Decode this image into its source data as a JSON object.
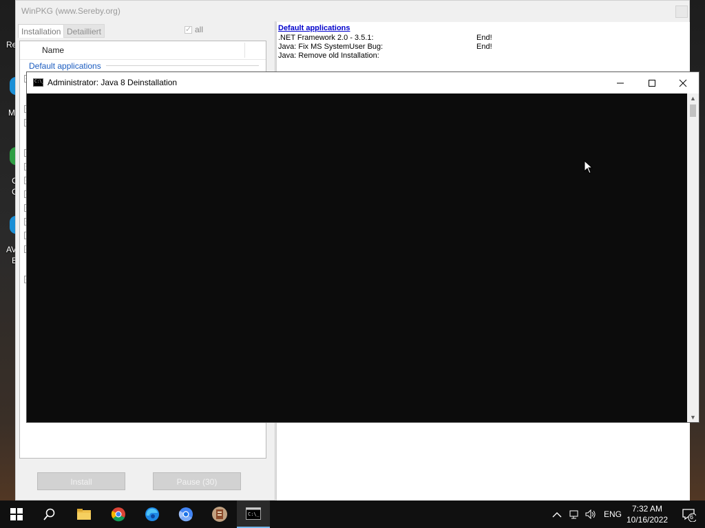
{
  "desktop": {
    "partial_labels": [
      "Re",
      "M",
      "C",
      "C",
      "AV",
      "E"
    ]
  },
  "winpkg": {
    "title": "WinPKG (www.Sereby.org)",
    "tabs": [
      {
        "label": "Installation",
        "active": true
      },
      {
        "label": "Detailliert",
        "active": false
      }
    ],
    "all_label": "all",
    "list_header": "Name",
    "group_label": "Default applications",
    "install_button": "Install",
    "pause_button": "Pause (30)"
  },
  "log": {
    "title": "Default applications",
    "rows": [
      {
        "label": ".NET Framework 2.0 - 3.5.1:",
        "status": "End!"
      },
      {
        "label": "Java: Fix MS SystemUser Bug:",
        "status": "End!"
      },
      {
        "label": "Java: Remove old Installation:",
        "status": ""
      }
    ]
  },
  "console": {
    "title": "Administrator:  Java 8 Deinstallation",
    "icon_text": "C:\\_"
  },
  "taskbar": {
    "apps": [
      "start-icon",
      "search-icon",
      "file-explorer-icon",
      "chrome-icon",
      "edge-icon",
      "chromium-icon",
      "winpkg-icon",
      "cmd-icon"
    ],
    "language": "ENG",
    "time": "7:32 AM",
    "date": "10/16/2022",
    "notification_count": "6"
  },
  "colors": {
    "link_blue": "#0000cc",
    "group_blue": "#1a5bbf",
    "console_bg": "#0c0c0c",
    "taskbar_bg": "#101010"
  }
}
